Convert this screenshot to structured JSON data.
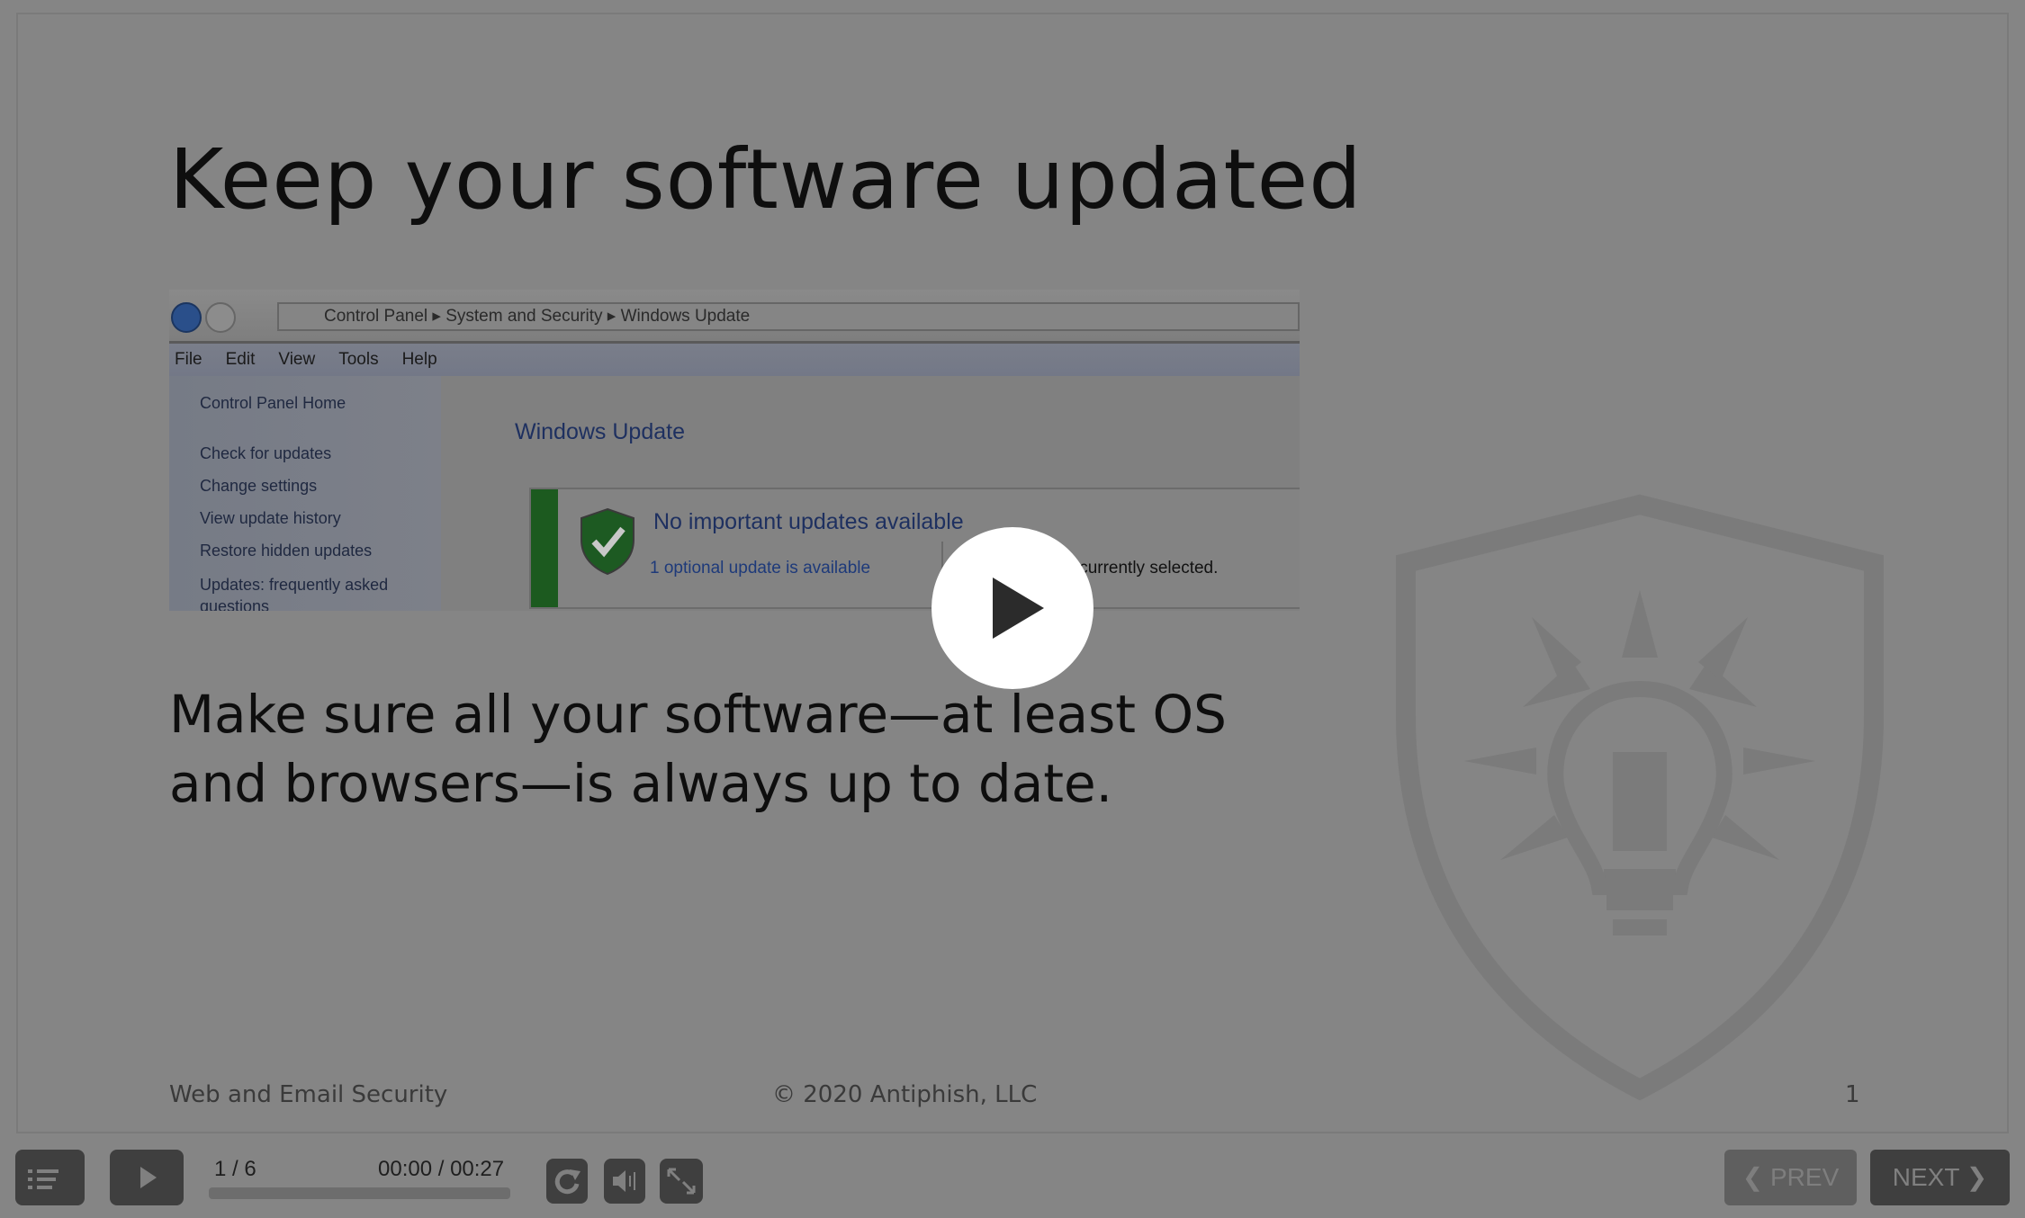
{
  "slide": {
    "title": "Keep your software updated",
    "body": "Make sure all your software—at least OS and browsers—is always up to date.",
    "footer_left": "Web and Email Security",
    "footer_center": "© 2020 Antiphish, LLC",
    "page_number": "1",
    "watermark_icon": "shield-lightbulb-icon"
  },
  "screenshot": {
    "breadcrumb": [
      "Control Panel",
      "System and Security",
      "Windows Update"
    ],
    "menu": [
      "File",
      "Edit",
      "View",
      "Tools",
      "Help"
    ],
    "sidebar": [
      "Control Panel Home",
      "Check for updates",
      "Change settings",
      "View update history",
      "Restore hidden updates",
      "Updates: frequently asked questions"
    ],
    "heading": "Windows Update",
    "status_title": "No important updates available",
    "optional_link": "1 optional update is available",
    "selected_text": "No updates are currently selected."
  },
  "player": {
    "slide_counter": "1 / 6",
    "time": "00:00 / 00:27",
    "progress_percent": 0,
    "prev_label": "PREV",
    "next_label": "NEXT"
  },
  "colors": {
    "background": "#858585",
    "button": "#3f3f3f",
    "prev_button": "#5f5f5f"
  }
}
